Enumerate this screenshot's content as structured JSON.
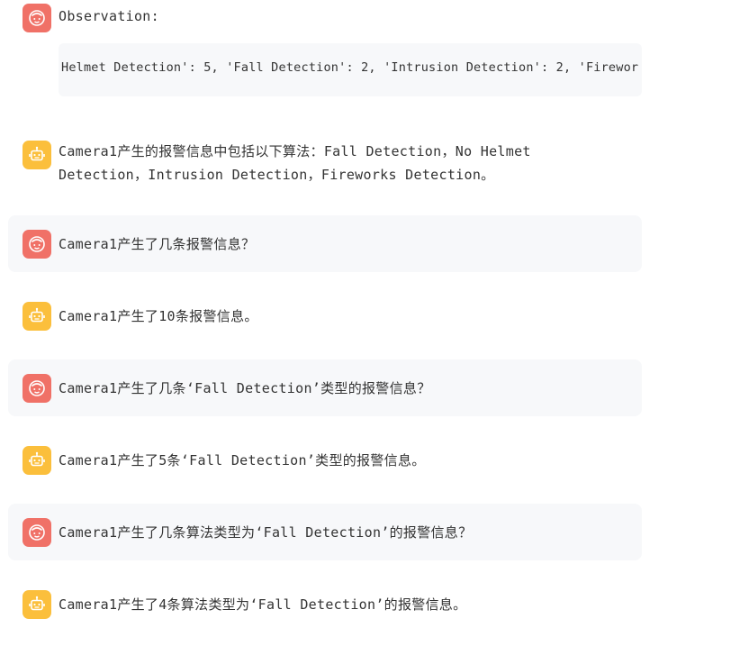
{
  "colors": {
    "user_avatar": "#f07167",
    "bot_avatar": "#fbbf3c",
    "user_bubble": "#f7f8fa"
  },
  "observation": {
    "label": "Observation:",
    "code": "Helmet Detection': 5, 'Fall Detection': 2, 'Intrusion Detection': 2, 'Firewor"
  },
  "messages": [
    {
      "role": "bot",
      "icon": "robot-icon",
      "text": "Camera1产生的报警信息中包括以下算法：Fall Detection，No Helmet Detection，Intrusion Detection，Fireworks Detection。"
    },
    {
      "role": "user",
      "icon": "user-face-icon",
      "text": "Camera1产生了几条报警信息？"
    },
    {
      "role": "bot",
      "icon": "robot-icon",
      "text": "Camera1产生了10条报警信息。"
    },
    {
      "role": "user",
      "icon": "user-face-icon",
      "text": "Camera1产生了几条‘Fall Detection’类型的报警信息？"
    },
    {
      "role": "bot",
      "icon": "robot-icon",
      "text": "Camera1产生了5条‘Fall Detection’类型的报警信息。"
    },
    {
      "role": "user",
      "icon": "user-face-icon",
      "text": "Camera1产生了几条算法类型为‘Fall Detection’的报警信息？"
    },
    {
      "role": "bot",
      "icon": "robot-icon",
      "text": "Camera1产生了4条算法类型为‘Fall Detection’的报警信息。"
    }
  ]
}
